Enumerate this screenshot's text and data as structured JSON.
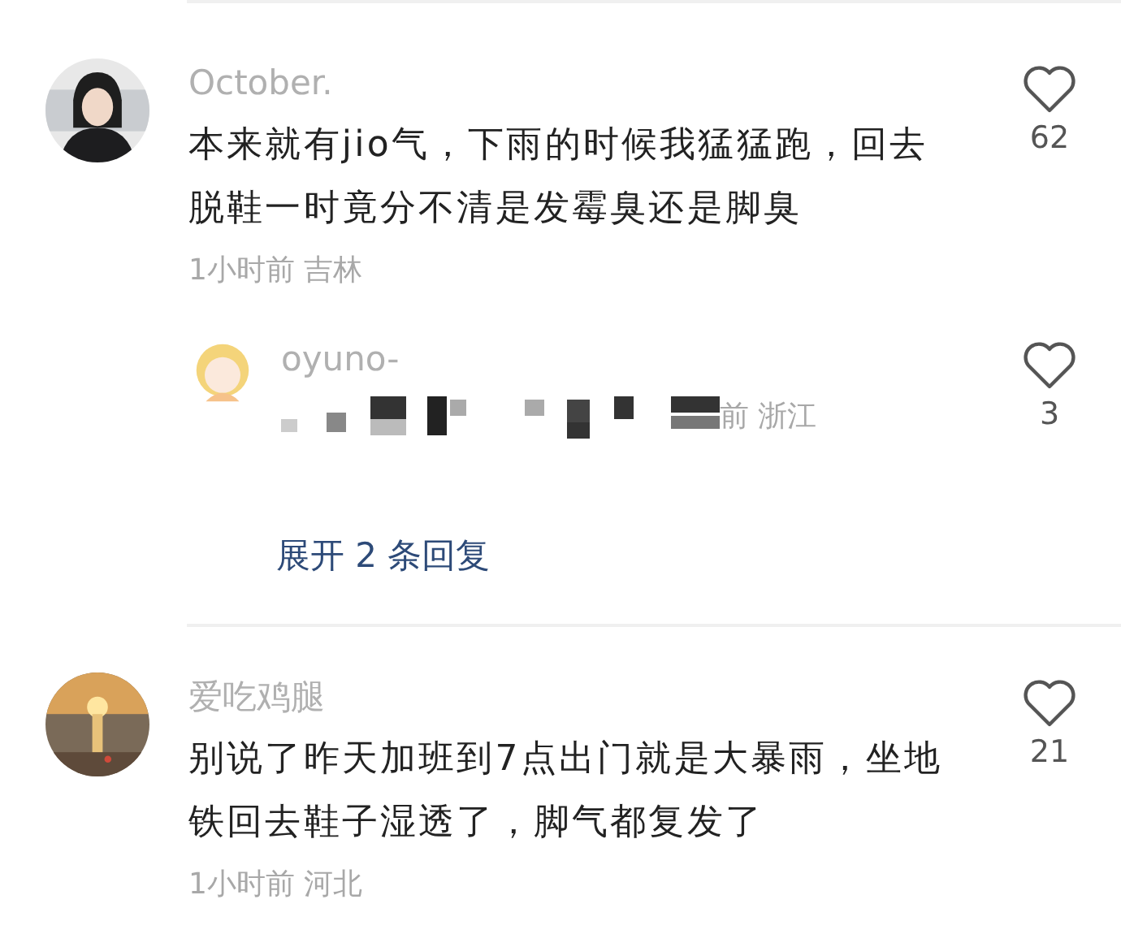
{
  "comments": [
    {
      "user": "October.",
      "text": "本来就有jio气，下雨的时候我猛猛跑，回去脱鞋一时竟分不清是发霉臭还是脚臭",
      "meta": "1小时前 吉林",
      "likes": "62",
      "replies": [
        {
          "user": "oyuno-",
          "redacted": true,
          "meta": "前 浙江",
          "likes": "3"
        }
      ],
      "expand": "展开 2 条回复"
    },
    {
      "user": "爱吃鸡腿",
      "text": "别说了昨天加班到7点出门就是大暴雨，坐地铁回去鞋子湿透了，脚气都复发了",
      "meta": "1小时前 河北",
      "likes": "21"
    }
  ]
}
